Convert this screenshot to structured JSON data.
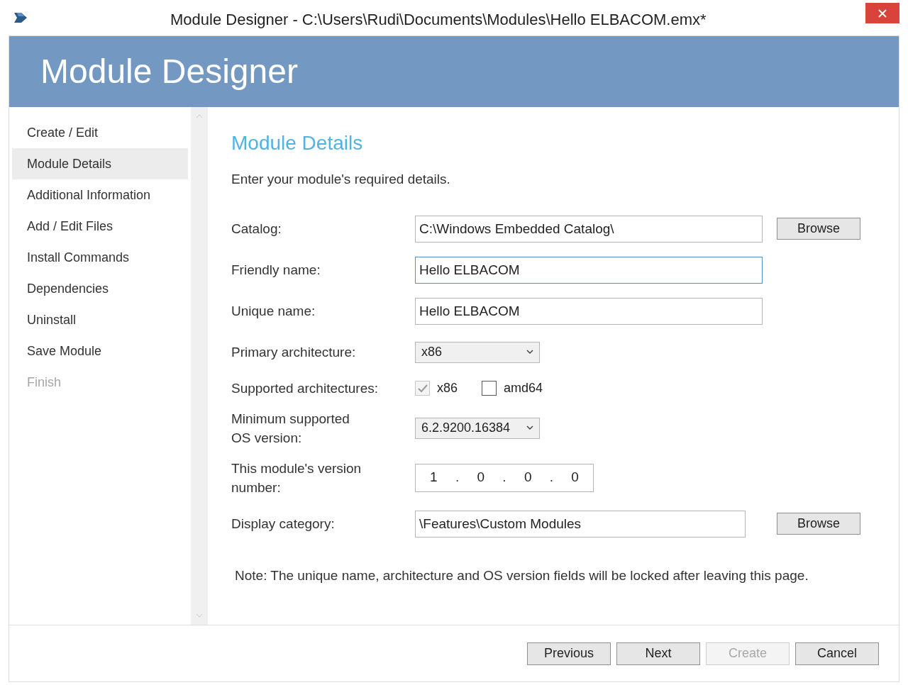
{
  "window": {
    "title": "Module Designer - C:\\Users\\Rudi\\Documents\\Modules\\Hello ELBACOM.emx*"
  },
  "header": {
    "title": "Module Designer"
  },
  "sidebar": {
    "items": [
      {
        "label": "Create / Edit",
        "selected": false,
        "disabled": false
      },
      {
        "label": "Module Details",
        "selected": true,
        "disabled": false
      },
      {
        "label": "Additional Information",
        "selected": false,
        "disabled": false
      },
      {
        "label": "Add / Edit Files",
        "selected": false,
        "disabled": false
      },
      {
        "label": "Install Commands",
        "selected": false,
        "disabled": false
      },
      {
        "label": "Dependencies",
        "selected": false,
        "disabled": false
      },
      {
        "label": "Uninstall",
        "selected": false,
        "disabled": false
      },
      {
        "label": "Save Module",
        "selected": false,
        "disabled": false
      },
      {
        "label": "Finish",
        "selected": false,
        "disabled": true
      }
    ]
  },
  "content": {
    "heading": "Module Details",
    "intro": "Enter your module's required details.",
    "fields": [
      {
        "kind": "text",
        "label": "Catalog:",
        "value": "C:\\Windows Embedded Catalog\\",
        "focused": false,
        "button": "Browse"
      },
      {
        "kind": "text",
        "label": "Friendly name:",
        "value": "Hello ELBACOM",
        "focused": true
      },
      {
        "kind": "text",
        "label": "Unique name:",
        "value": "Hello ELBACOM",
        "focused": false
      },
      {
        "kind": "select",
        "label": "Primary architecture:",
        "value": "x86"
      },
      {
        "kind": "checks",
        "label": "Supported architectures:",
        "options": [
          {
            "label": "x86",
            "checked": true,
            "disabled": true
          },
          {
            "label": "amd64",
            "checked": false,
            "disabled": false
          }
        ]
      },
      {
        "kind": "select",
        "label": "Minimum supported\nOS version:",
        "value": "6.2.9200.16384"
      },
      {
        "kind": "version",
        "label": "This module's version\nnumber:",
        "parts": [
          "1",
          "0",
          "0",
          "0"
        ],
        "separators": [
          ".",
          ".",
          "."
        ]
      },
      {
        "kind": "text",
        "label": "Display category:",
        "value": "\\Features\\Custom Modules",
        "focused": false,
        "button": "Browse"
      }
    ],
    "note": "Note: The unique name, architecture and OS version fields will be locked after leaving this page."
  },
  "buttons": [
    {
      "label": "Previous",
      "disabled": false
    },
    {
      "label": "Next",
      "disabled": false
    },
    {
      "label": "Create",
      "disabled": true
    },
    {
      "label": "Cancel",
      "disabled": false
    }
  ]
}
